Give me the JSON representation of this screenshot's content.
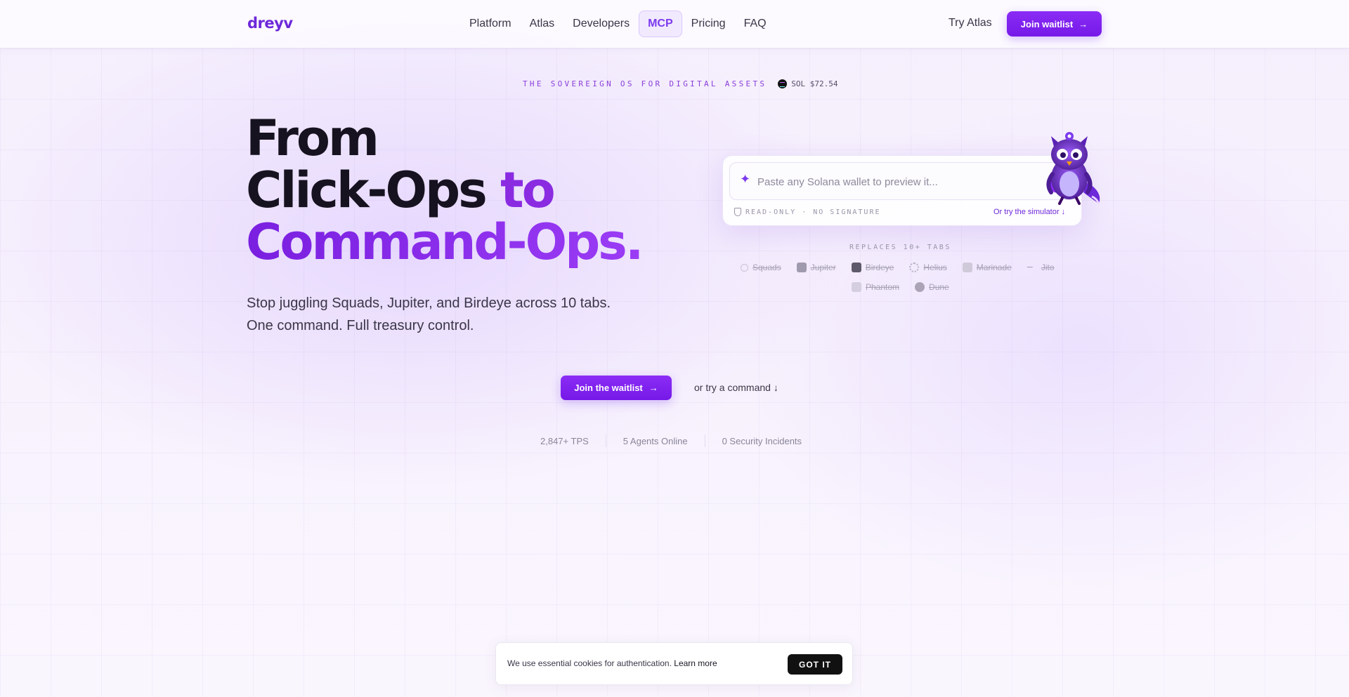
{
  "nav": {
    "logo": "dreyv",
    "links": [
      "Platform",
      "Atlas",
      "Developers",
      "MCP",
      "Pricing",
      "FAQ"
    ],
    "active": "MCP",
    "try_atlas": "Try Atlas",
    "cta": "Join waitlist"
  },
  "hero": {
    "tagline": "THE SOVEREIGN OS FOR DIGITAL ASSETS",
    "sol_price": "SOL $72.54",
    "headline_line1": "From",
    "headline_line2_a": "Click-Ops ",
    "headline_line2_b": "to",
    "headline_line3": "Command-Ops.",
    "subhead_line1": "Stop juggling Squads, Jupiter, and Birdeye across 10 tabs.",
    "subhead_line2": "One command. Full treasury control.",
    "cta": "Join the waitlist",
    "cta_secondary": "or try a command ↓"
  },
  "search": {
    "placeholder": "Paste any Solana wallet to preview it...",
    "readonly_label": "READ-ONLY · NO SIGNATURE",
    "simulator_link": "Or try the simulator ↓"
  },
  "replaces": {
    "label": "REPLACES 10+ TABS",
    "row1": [
      "Squads",
      "Jupiter",
      "Birdeye",
      "Helius",
      "Marinade",
      "Jito"
    ],
    "row2": [
      "Phantom",
      "Dune"
    ]
  },
  "stats": [
    "2,847+ TPS",
    "5 Agents Online",
    "0 Security Incidents"
  ],
  "cookie": {
    "text": "We use essential cookies for authentication.",
    "link": "Learn more",
    "button": "GOT IT"
  },
  "colors": {
    "accent": "#7c3aed",
    "accent_dark": "#6d28d9",
    "text": "#1a1523"
  }
}
